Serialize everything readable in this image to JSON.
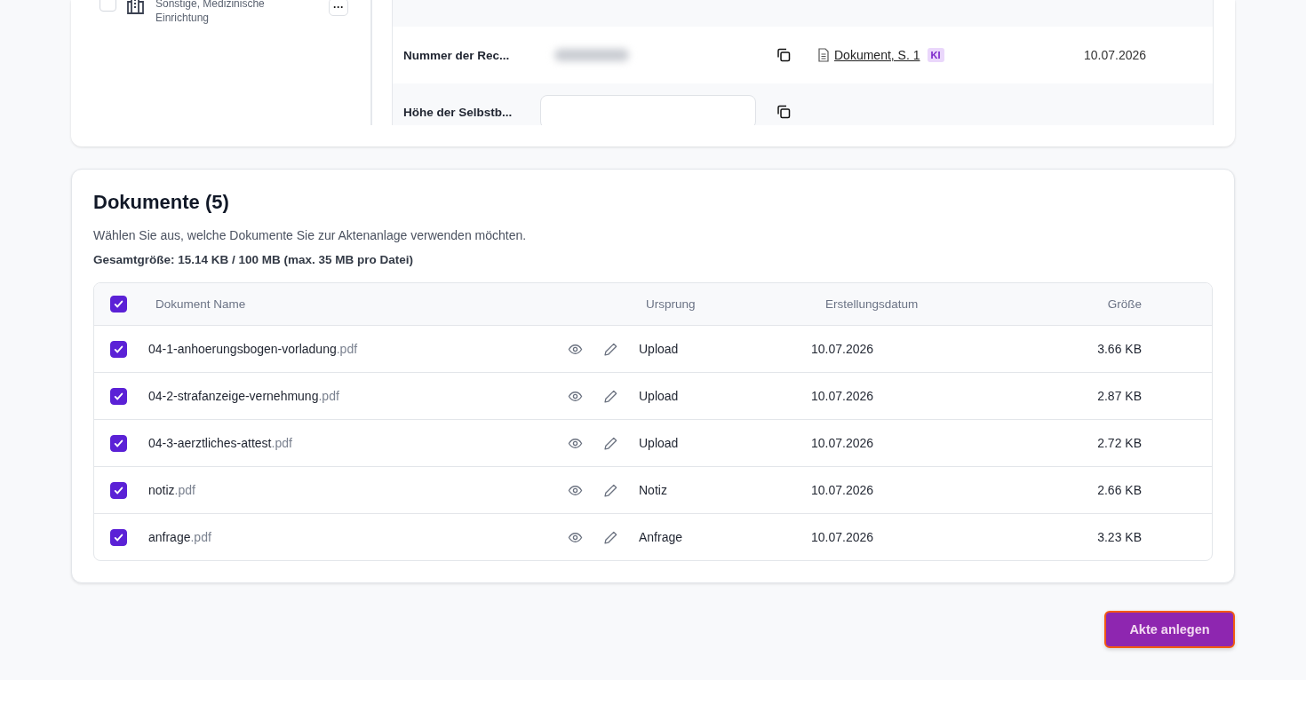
{
  "entity_panel": {
    "item": {
      "checked": false,
      "label": "Sonstige, Medizinische Einrichtung",
      "menu": "···"
    }
  },
  "fields": [
    {
      "label": "Nummer der Rec...",
      "kind": "blurred",
      "source": "Dokument, S. 1",
      "badge": "KI",
      "date": "10.07.2026"
    },
    {
      "label": "Höhe der Selbstb...",
      "kind": "input"
    }
  ],
  "documents": {
    "title": "Dokumente (5)",
    "description": "Wählen Sie aus, welche Dokumente Sie zur Aktenanlage verwenden möchten.",
    "total": "Gesamtgröße: 15.14 KB / 100 MB (max. 35 MB pro Datei)",
    "all_checked": true,
    "columns": [
      "Dokument Name",
      "Ursprung",
      "Erstellungsdatum",
      "Größe"
    ],
    "rows": [
      {
        "checked": true,
        "name": "04-1-anhoerungsbogen-vorladung.pdf",
        "origin": "Upload",
        "date": "10.07.2026",
        "size": "3.66 KB"
      },
      {
        "checked": true,
        "name": "04-2-strafanzeige-vernehmung.pdf",
        "origin": "Upload",
        "date": "10.07.2026",
        "size": "2.87 KB"
      },
      {
        "checked": true,
        "name": "04-3-aerztliches-attest.pdf",
        "origin": "Upload",
        "date": "10.07.2026",
        "size": "2.72 KB"
      },
      {
        "checked": true,
        "name": "notiz.pdf",
        "origin": "Notiz",
        "date": "10.07.2026",
        "size": "2.66 KB"
      },
      {
        "checked": true,
        "name": "anfrage.pdf",
        "origin": "Anfrage",
        "date": "10.07.2026",
        "size": "3.23 KB"
      }
    ]
  },
  "submit_button": {
    "label": "Akte anlegen"
  }
}
